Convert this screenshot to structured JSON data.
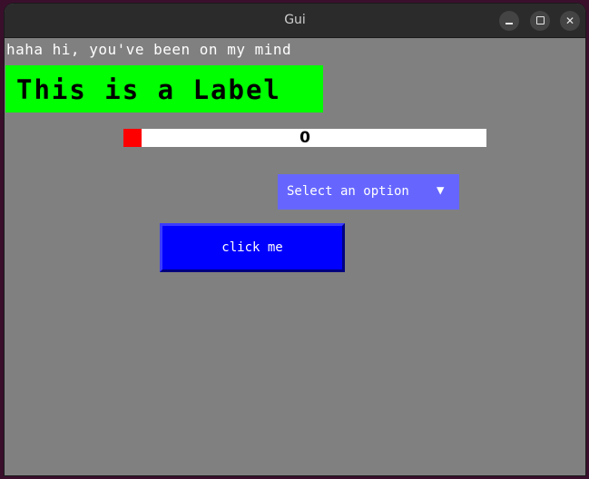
{
  "window": {
    "title": "Gui"
  },
  "controls": {
    "minimize_icon": "minimize-icon",
    "maximize_icon": "maximize-icon",
    "close_icon": "close-icon",
    "close_glyph": "✕"
  },
  "content": {
    "greeting": "haha hi, you've been on my mind",
    "label": "This is a Label",
    "progress": {
      "value": 0,
      "display": "0",
      "fill_fraction": 0.05,
      "fill_color": "#ff0000",
      "track_color": "#ffffff"
    },
    "dropdown": {
      "label": "Select an option",
      "arrow": "▼",
      "color": "#6666ff"
    },
    "button": {
      "label": "click me",
      "color": "#0000ff"
    }
  },
  "colors": {
    "window_bg": "#808080",
    "label_bg": "#00ff00"
  }
}
